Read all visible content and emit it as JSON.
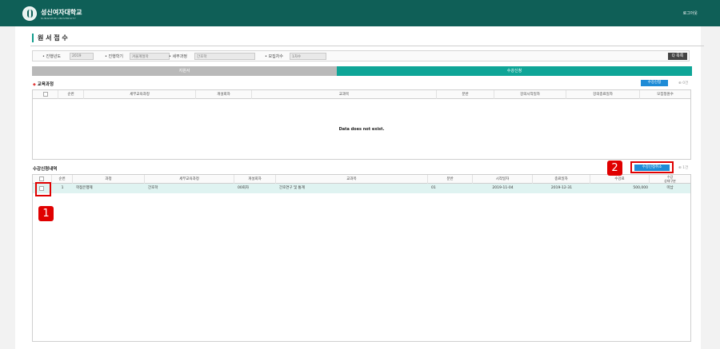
{
  "header": {
    "brand": "성신여자대학교",
    "brand_sub": "SUNGSHIN UNIVERSITY",
    "logout": "로그아웃"
  },
  "page": {
    "title": "원 서 접 수"
  },
  "filter": {
    "year_label": "• 진행년도",
    "year_value": "2019",
    "term_label": "• 진행학기",
    "term_value": "겨울계절학",
    "course_label": "• 세부과정",
    "course_value": "간호학",
    "round_label": "• 모집차수",
    "round_value": "1차수",
    "list_button": "Q 목록"
  },
  "tabs": {
    "left": "지원서",
    "right": "수강신청"
  },
  "curriculum": {
    "title": "교육과정",
    "apply_button": "수강신청",
    "count": "0건",
    "columns": [
      "",
      "순번",
      "세부교육과정",
      "개설회차",
      "교과목",
      "분반",
      "강의시작일자",
      "강의종료일자",
      "모집정원수"
    ],
    "empty_text": "Data does not exist."
  },
  "history": {
    "title": "수강신청내역",
    "cancel_button": "수강신청취소",
    "count": "1건",
    "columns": [
      "",
      "순번",
      "과정",
      "세부교육과정",
      "개설회차",
      "교과목",
      "분반",
      "시작일자",
      "종료일자",
      "수강료",
      "수강\n상태구분"
    ],
    "rows": [
      {
        "no": "1",
        "course": "학점은행제",
        "detail": "간호학",
        "round": "00회차",
        "subject": "간호연구 및 통계",
        "section": "01",
        "start": "2019-11-04",
        "end": "2019-12-31",
        "fee": "500,000",
        "status": "미납"
      }
    ]
  },
  "annotations": {
    "marker1": "1",
    "marker2": "2"
  },
  "colors": {
    "topbar": "#0f5f57",
    "accent": "#0fa597",
    "button": "#1e8bd6",
    "annotation": "#e00000"
  }
}
